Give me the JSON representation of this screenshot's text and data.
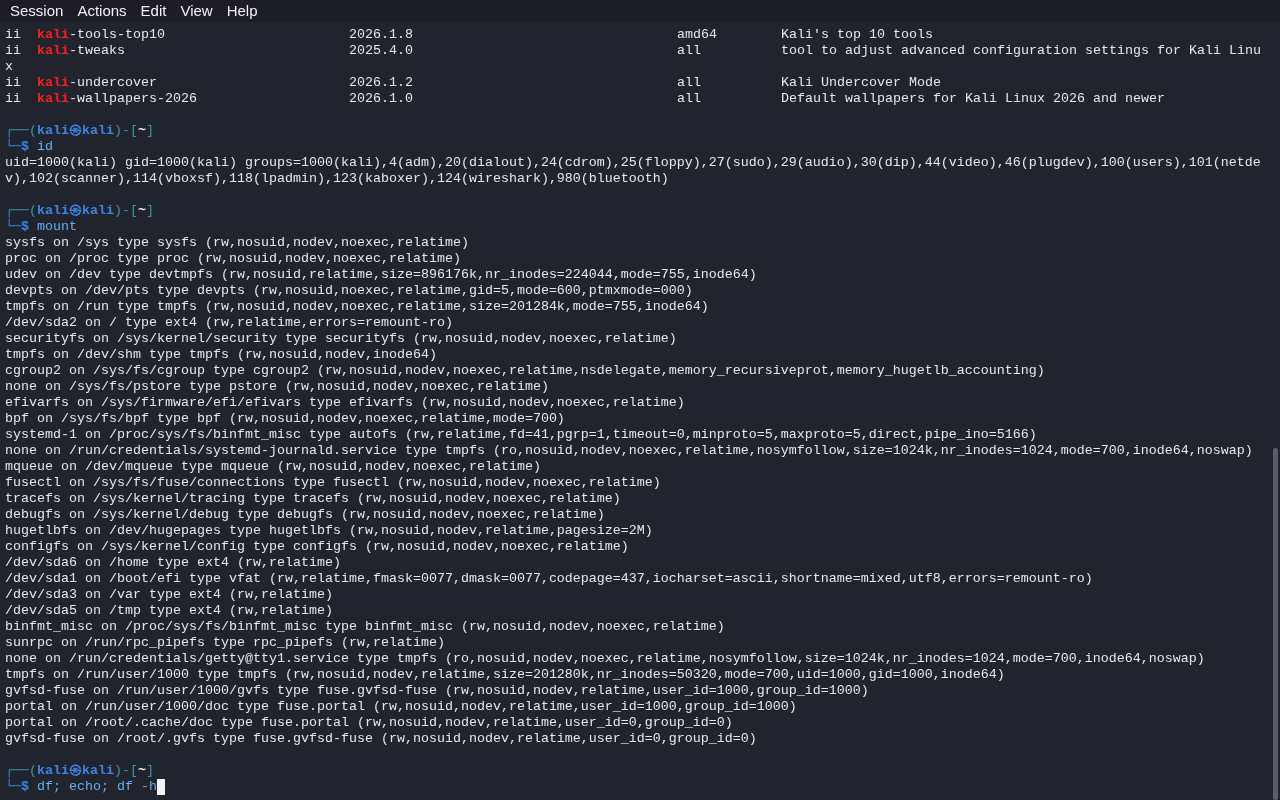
{
  "menu": [
    "Session",
    "Actions",
    "Edit",
    "View",
    "Help"
  ],
  "lines": [
    {
      "kind": "package",
      "status": "ii",
      "name": [
        {
          "kind": "match",
          "text": "kali"
        },
        {
          "kind": "plain",
          "text": "-tools-top10"
        }
      ],
      "version": "2026.1.8",
      "arch": "amd64",
      "description": "Kali's top 10 tools"
    },
    {
      "kind": "package",
      "status": "ii",
      "name": [
        {
          "kind": "match",
          "text": "kali"
        },
        {
          "kind": "plain",
          "text": "-tweaks"
        }
      ],
      "version": "2025.4.0",
      "arch": "all",
      "description": "tool to adjust advanced configuration settings for Kali Linu"
    },
    {
      "kind": "output",
      "text": "x"
    },
    {
      "kind": "package",
      "status": "ii",
      "name": [
        {
          "kind": "match",
          "text": "kali"
        },
        {
          "kind": "plain",
          "text": "-undercover"
        }
      ],
      "version": "2026.1.2",
      "arch": "all",
      "description": "Kali Undercover Mode"
    },
    {
      "kind": "package",
      "status": "ii",
      "name": [
        {
          "kind": "match",
          "text": "kali"
        },
        {
          "kind": "plain",
          "text": "-wallpapers-2026"
        }
      ],
      "version": "2026.1.0",
      "arch": "all",
      "description": "Default wallpapers for Kali Linux 2026 and newer"
    },
    {
      "kind": "blank"
    },
    {
      "kind": "prompt",
      "cursor": false,
      "header": [
        {
          "kind": "frame",
          "text": "┌──("
        },
        {
          "kind": "user",
          "text": "kali㉿kali"
        },
        {
          "kind": "frame",
          "text": ")-["
        },
        {
          "kind": "dir",
          "text": "~"
        },
        {
          "kind": "frame",
          "text": "]"
        }
      ],
      "sigil": "└─$",
      "command": "id"
    },
    {
      "kind": "output",
      "text": "uid=1000(kali) gid=1000(kali) groups=1000(kali),4(adm),20(dialout),24(cdrom),25(floppy),27(sudo),29(audio),30(dip),44(video),46(plugdev),100(users),101(netde"
    },
    {
      "kind": "output",
      "text": "v),102(scanner),114(vboxsf),118(lpadmin),123(kaboxer),124(wireshark),980(bluetooth)"
    },
    {
      "kind": "blank"
    },
    {
      "kind": "prompt",
      "cursor": false,
      "header": [
        {
          "kind": "frame",
          "text": "┌──("
        },
        {
          "kind": "user",
          "text": "kali㉿kali"
        },
        {
          "kind": "frame",
          "text": ")-["
        },
        {
          "kind": "dir",
          "text": "~"
        },
        {
          "kind": "frame",
          "text": "]"
        }
      ],
      "sigil": "└─$",
      "command": "mount"
    },
    {
      "kind": "output",
      "text": "sysfs on /sys type sysfs (rw,nosuid,nodev,noexec,relatime)"
    },
    {
      "kind": "output",
      "text": "proc on /proc type proc (rw,nosuid,nodev,noexec,relatime)"
    },
    {
      "kind": "output",
      "text": "udev on /dev type devtmpfs (rw,nosuid,relatime,size=896176k,nr_inodes=224044,mode=755,inode64)"
    },
    {
      "kind": "output",
      "text": "devpts on /dev/pts type devpts (rw,nosuid,noexec,relatime,gid=5,mode=600,ptmxmode=000)"
    },
    {
      "kind": "output",
      "text": "tmpfs on /run type tmpfs (rw,nosuid,nodev,noexec,relatime,size=201284k,mode=755,inode64)"
    },
    {
      "kind": "output",
      "text": "/dev/sda2 on / type ext4 (rw,relatime,errors=remount-ro)"
    },
    {
      "kind": "output",
      "text": "securityfs on /sys/kernel/security type securityfs (rw,nosuid,nodev,noexec,relatime)"
    },
    {
      "kind": "output",
      "text": "tmpfs on /dev/shm type tmpfs (rw,nosuid,nodev,inode64)"
    },
    {
      "kind": "output",
      "text": "cgroup2 on /sys/fs/cgroup type cgroup2 (rw,nosuid,nodev,noexec,relatime,nsdelegate,memory_recursiveprot,memory_hugetlb_accounting)"
    },
    {
      "kind": "output",
      "text": "none on /sys/fs/pstore type pstore (rw,nosuid,nodev,noexec,relatime)"
    },
    {
      "kind": "output",
      "text": "efivarfs on /sys/firmware/efi/efivars type efivarfs (rw,nosuid,nodev,noexec,relatime)"
    },
    {
      "kind": "output",
      "text": "bpf on /sys/fs/bpf type bpf (rw,nosuid,nodev,noexec,relatime,mode=700)"
    },
    {
      "kind": "output",
      "text": "systemd-1 on /proc/sys/fs/binfmt_misc type autofs (rw,relatime,fd=41,pgrp=1,timeout=0,minproto=5,maxproto=5,direct,pipe_ino=5166)"
    },
    {
      "kind": "output",
      "text": "none on /run/credentials/systemd-journald.service type tmpfs (ro,nosuid,nodev,noexec,relatime,nosymfollow,size=1024k,nr_inodes=1024,mode=700,inode64,noswap)"
    },
    {
      "kind": "output",
      "text": "mqueue on /dev/mqueue type mqueue (rw,nosuid,nodev,noexec,relatime)"
    },
    {
      "kind": "output",
      "text": "fusectl on /sys/fs/fuse/connections type fusectl (rw,nosuid,nodev,noexec,relatime)"
    },
    {
      "kind": "output",
      "text": "tracefs on /sys/kernel/tracing type tracefs (rw,nosuid,nodev,noexec,relatime)"
    },
    {
      "kind": "output",
      "text": "debugfs on /sys/kernel/debug type debugfs (rw,nosuid,nodev,noexec,relatime)"
    },
    {
      "kind": "output",
      "text": "hugetlbfs on /dev/hugepages type hugetlbfs (rw,nosuid,nodev,relatime,pagesize=2M)"
    },
    {
      "kind": "output",
      "text": "configfs on /sys/kernel/config type configfs (rw,nosuid,nodev,noexec,relatime)"
    },
    {
      "kind": "output",
      "text": "/dev/sda6 on /home type ext4 (rw,relatime)"
    },
    {
      "kind": "output",
      "text": "/dev/sda1 on /boot/efi type vfat (rw,relatime,fmask=0077,dmask=0077,codepage=437,iocharset=ascii,shortname=mixed,utf8,errors=remount-ro)"
    },
    {
      "kind": "output",
      "text": "/dev/sda3 on /var type ext4 (rw,relatime)"
    },
    {
      "kind": "output",
      "text": "/dev/sda5 on /tmp type ext4 (rw,relatime)"
    },
    {
      "kind": "output",
      "text": "binfmt_misc on /proc/sys/fs/binfmt_misc type binfmt_misc (rw,nosuid,nodev,noexec,relatime)"
    },
    {
      "kind": "output",
      "text": "sunrpc on /run/rpc_pipefs type rpc_pipefs (rw,relatime)"
    },
    {
      "kind": "output",
      "text": "none on /run/credentials/getty@tty1.service type tmpfs (ro,nosuid,nodev,noexec,relatime,nosymfollow,size=1024k,nr_inodes=1024,mode=700,inode64,noswap)"
    },
    {
      "kind": "output",
      "text": "tmpfs on /run/user/1000 type tmpfs (rw,nosuid,nodev,relatime,size=201280k,nr_inodes=50320,mode=700,uid=1000,gid=1000,inode64)"
    },
    {
      "kind": "output",
      "text": "gvfsd-fuse on /run/user/1000/gvfs type fuse.gvfsd-fuse (rw,nosuid,nodev,relatime,user_id=1000,group_id=1000)"
    },
    {
      "kind": "output",
      "text": "portal on /run/user/1000/doc type fuse.portal (rw,nosuid,nodev,relatime,user_id=1000,group_id=1000)"
    },
    {
      "kind": "output",
      "text": "portal on /root/.cache/doc type fuse.portal (rw,nosuid,nodev,relatime,user_id=0,group_id=0)"
    },
    {
      "kind": "output",
      "text": "gvfsd-fuse on /root/.gvfs type fuse.gvfsd-fuse (rw,nosuid,nodev,relatime,user_id=0,group_id=0)"
    },
    {
      "kind": "blank"
    },
    {
      "kind": "prompt",
      "cursor": true,
      "header": [
        {
          "kind": "frame",
          "text": "┌──("
        },
        {
          "kind": "user",
          "text": "kali㉿kali"
        },
        {
          "kind": "frame",
          "text": ")-["
        },
        {
          "kind": "dir",
          "text": "~"
        },
        {
          "kind": "frame",
          "text": "]"
        }
      ],
      "sigil": "└─$",
      "command": "df; echo; df -h"
    }
  ]
}
